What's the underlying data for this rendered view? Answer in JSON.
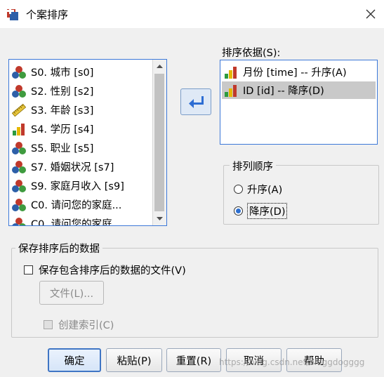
{
  "window": {
    "title": "个案排序",
    "close_label": "✕"
  },
  "variable_list": {
    "items": [
      {
        "label": "S0. 城市 [s0]",
        "icon": "nominal-icon"
      },
      {
        "label": "S2. 性别 [s2]",
        "icon": "nominal-icon"
      },
      {
        "label": "S3. 年龄 [s3]",
        "icon": "scale-ruler-icon"
      },
      {
        "label": "S4. 学历 [s4]",
        "icon": "ordinal-bar-icon"
      },
      {
        "label": "S5. 职业 [s5]",
        "icon": "nominal-icon"
      },
      {
        "label": "S7. 婚姻状况 [s7]",
        "icon": "nominal-icon"
      },
      {
        "label": "S9. 家庭月收入 [s9]",
        "icon": "nominal-icon"
      },
      {
        "label": "C0. 请问您的家庭...",
        "icon": "nominal-icon"
      },
      {
        "label": "C0. 请问您的家庭",
        "icon": "nominal-icon"
      }
    ]
  },
  "sort_by": {
    "label": "排序依据(S):",
    "items": [
      {
        "label": "月份 [time] -- 升序(A)",
        "icon": "ordinal-bar-icon",
        "selected": false
      },
      {
        "label": "ID [id] -- 降序(D)",
        "icon": "ordinal-bar-icon",
        "selected": true
      }
    ]
  },
  "sort_order": {
    "title": "排列顺序",
    "ascending_label": "升序(A)",
    "descending_label": "降序(D)",
    "selected": "descending"
  },
  "save_group": {
    "title": "保存排序后的数据",
    "checkbox_label": "保存包含排序后的数据的文件(V)",
    "file_button_label": "文件(L)...",
    "index_checkbox_label": "创建索引(C)"
  },
  "buttons": {
    "ok": "确定",
    "paste": "粘贴(P)",
    "reset": "重置(R)",
    "cancel": "取消",
    "help": "帮助"
  },
  "watermark": "https://blog.csdn.net/bloggdogggg",
  "colors": {
    "accent": "#3c78d8",
    "selection": "#c9c9c9",
    "move_button": "#dfe9f6"
  }
}
